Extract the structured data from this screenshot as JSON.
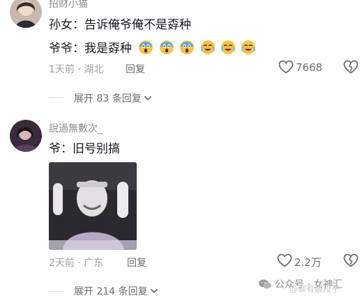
{
  "comment1": {
    "username": "招财小猫",
    "line1": "孙女：告诉俺爷俺不是孬种",
    "line2": "爷爷：我是孬种",
    "meta": "1天前 · 湖北",
    "reply_label": "回复",
    "like_count": "7668",
    "expand_label": "展开 83 条回复"
  },
  "comment2": {
    "username": "說過無數次_",
    "text": "爷：旧号别搞",
    "meta": "2天前 · 广东",
    "reply_label": "回复",
    "like_count": "2.2万",
    "expand_label": "展开 214 条回复"
  },
  "watermark": {
    "label": "公众号 · 女神汇",
    "faded": "@聊有趣段子"
  },
  "colors": {
    "text_primary": "#161823",
    "text_secondary": "#8a8b91",
    "emoji_face": "#f6c445",
    "scream_face": "#5aa3e8"
  },
  "icons": [
    "heart-icon",
    "broken-heart-icon",
    "chevron-down-icon",
    "wechat-icon",
    "screaming-face-emoji",
    "tearful-face-emoji"
  ]
}
